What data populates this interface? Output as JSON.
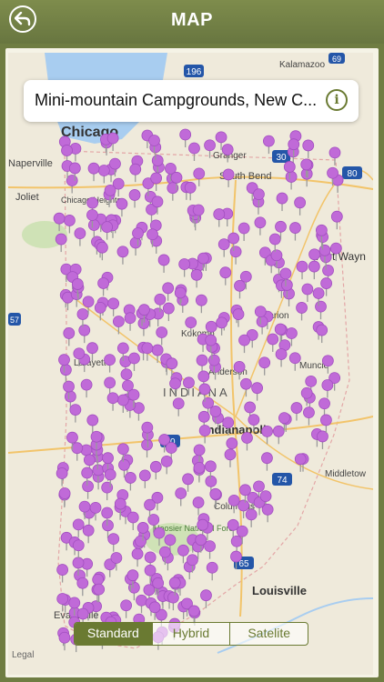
{
  "header": {
    "title": "MAP"
  },
  "info_card": {
    "text": "Mini-mountain Campgrounds, New C..."
  },
  "map": {
    "pin_color": "#c06ad8",
    "labels": {
      "chicago": "Chicago",
      "naperville": "Naperville",
      "joliet": "Joliet",
      "chicago_heights": "Chicago Heights",
      "granger": "Granger",
      "south_bend": "South Bend",
      "fort_wayne": "Fort Wayn",
      "kokomo": "Kokomo",
      "marion": "Marion",
      "lafayette": "Lafayette",
      "anderson": "Anderson",
      "muncie": "Muncie",
      "indiana": "INDIANA",
      "indianapolis": "Indianapolis",
      "middletown": "Middletow",
      "columbus": "Columbus",
      "hoosier": "Hoosier National Fore",
      "louisville": "Louisville",
      "evansville": "Evansville",
      "kalamazoo": "Kalamazoo",
      "legal": "Legal"
    },
    "shields": {
      "i196": "196",
      "i69": "69",
      "i80": "80",
      "i70": "70",
      "i74": "74",
      "i65": "65",
      "i57": "57",
      "i30": "30"
    }
  },
  "map_type": {
    "options": [
      "Standard",
      "Hybrid",
      "Satelite"
    ],
    "selected": "Standard"
  }
}
